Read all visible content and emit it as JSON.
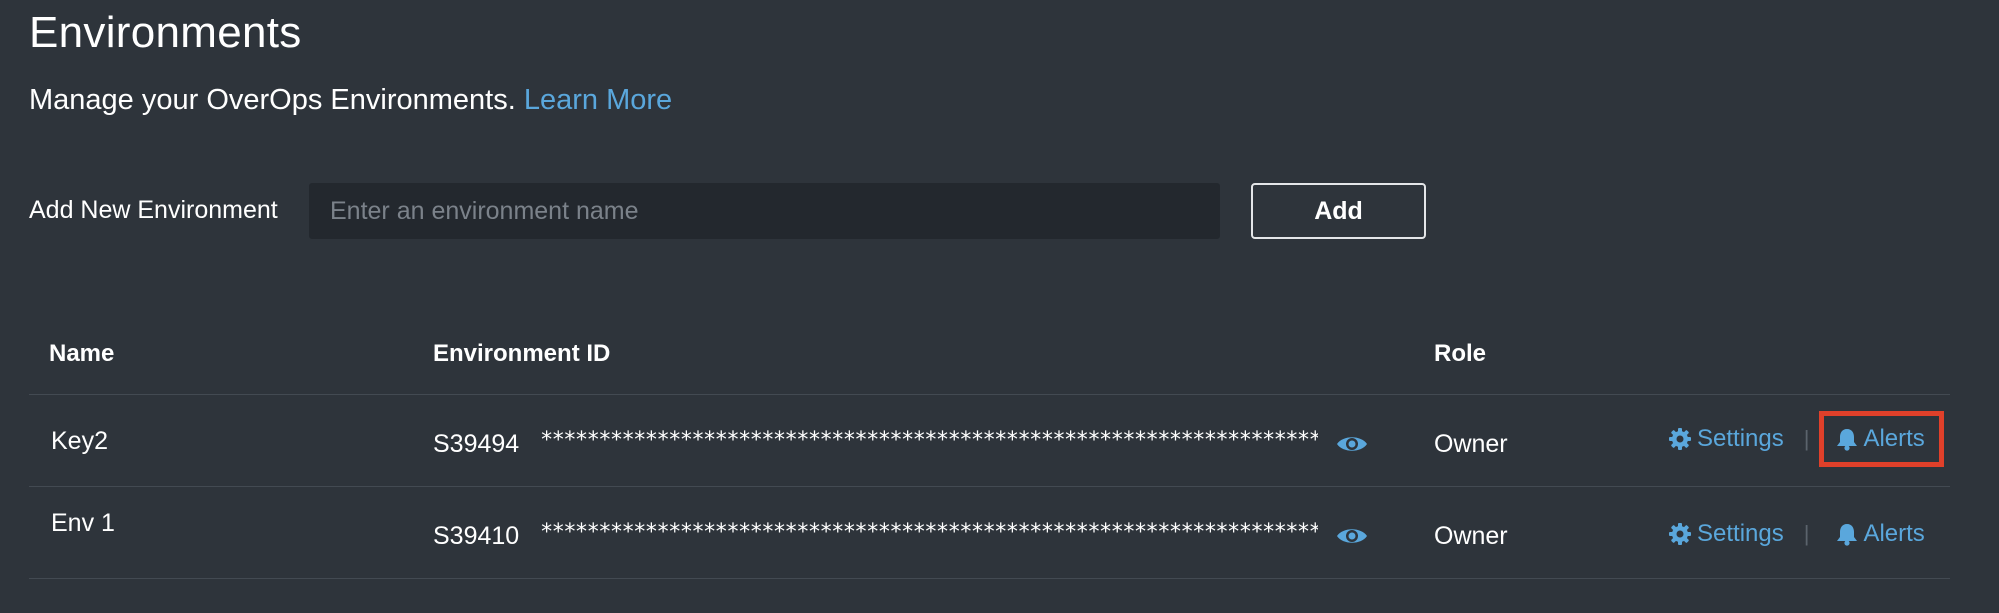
{
  "page": {
    "title": "Environments",
    "subtitle_text": "Manage your OverOps Environments.",
    "learn_more_link": "Learn More"
  },
  "add_env": {
    "label": "Add New Environment",
    "placeholder": "Enter an environment name",
    "value": "",
    "button_label": "Add"
  },
  "table": {
    "columns": {
      "name": "Name",
      "environment_id": "Environment ID",
      "role": "Role"
    },
    "rows": [
      {
        "name": "Key2",
        "env_id": "S39494",
        "masked_key": "************************************************************************************",
        "role": "Owner",
        "settings_label": "Settings",
        "alerts_label": "Alerts",
        "alerts_highlighted": true
      },
      {
        "name": "Env 1",
        "env_id": "S39410",
        "masked_key": "************************************************************************************",
        "role": "Owner",
        "settings_label": "Settings",
        "alerts_label": "Alerts",
        "alerts_highlighted": false
      }
    ]
  },
  "icons": {
    "reveal": "eye-icon",
    "settings": "gear-icon",
    "alerts": "bell-icon"
  },
  "colors": {
    "background": "#2e343b",
    "input_background": "#23282e",
    "link": "#5aa7dc",
    "highlight": "#e0402a",
    "divider": "#434a52"
  }
}
